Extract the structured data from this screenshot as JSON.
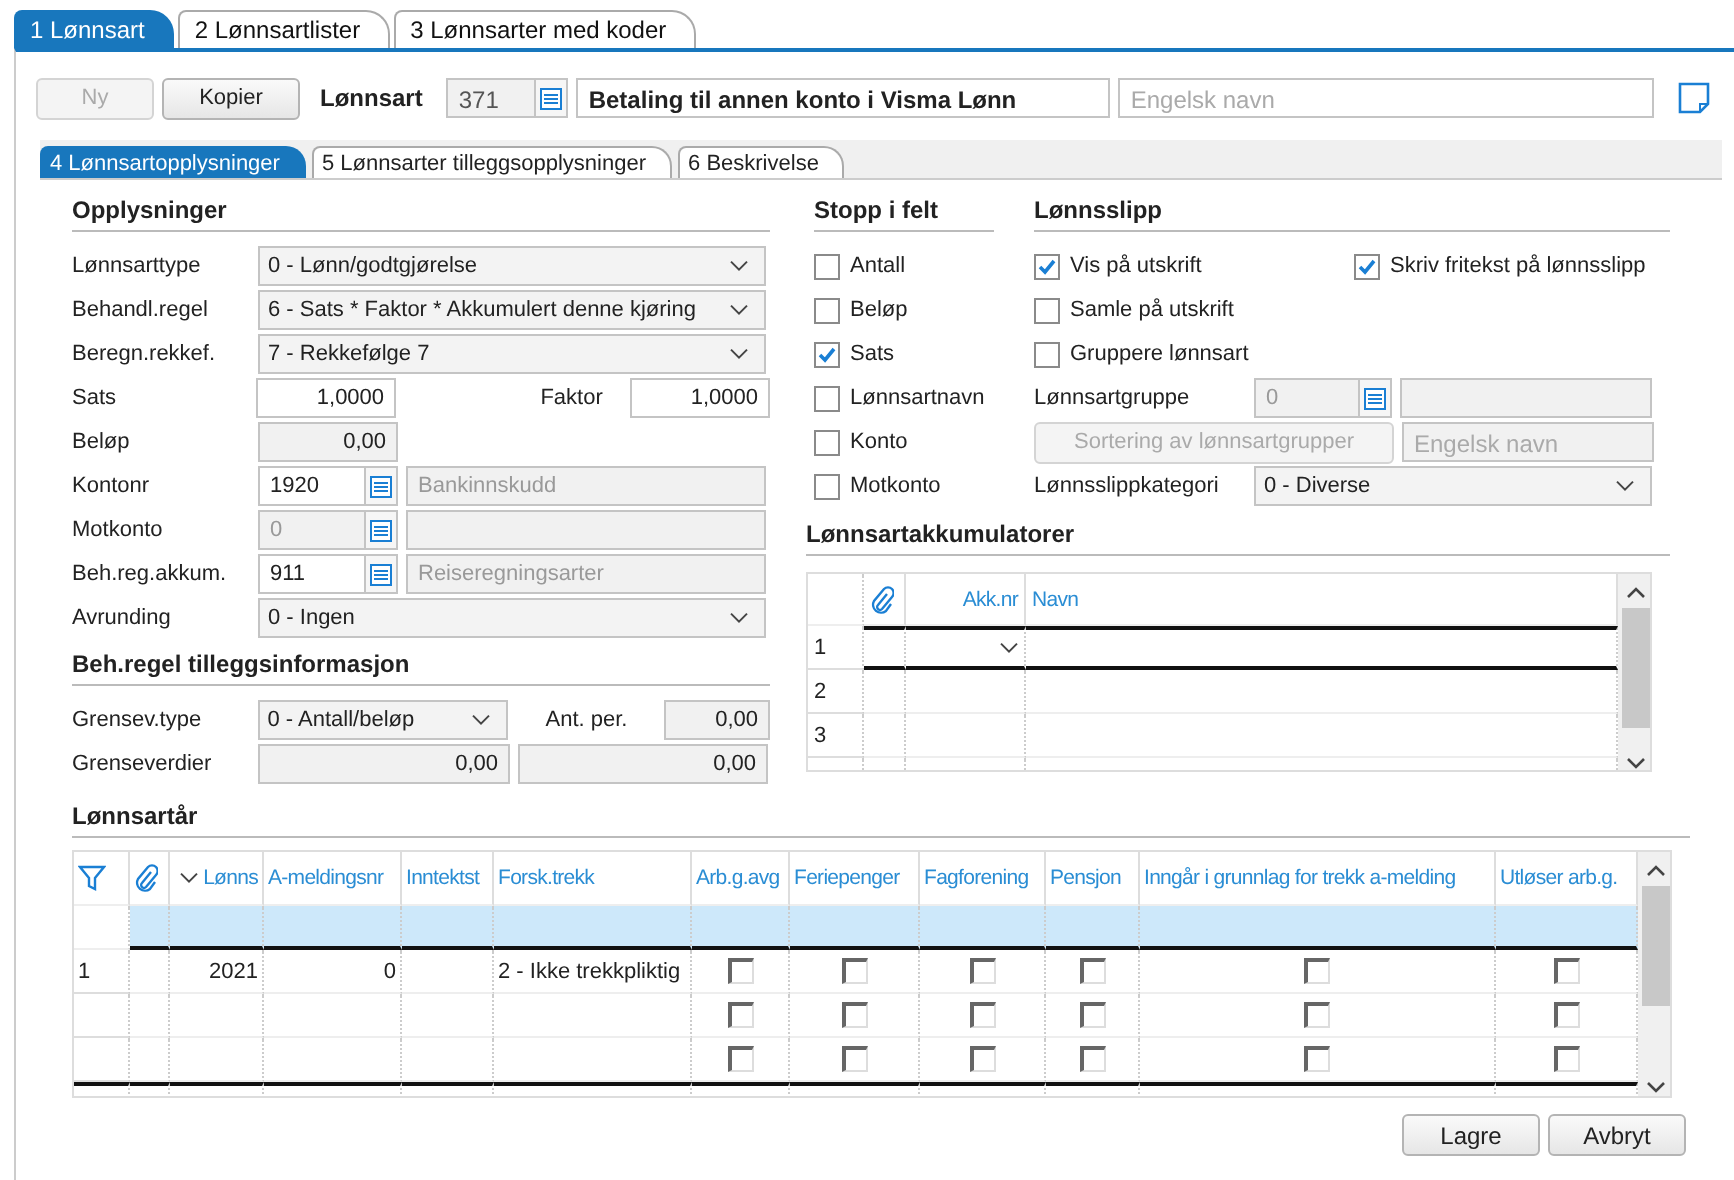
{
  "top_tabs": [
    {
      "label": "1 Lønnsart",
      "selected": true
    },
    {
      "label": "2 Lønnsartlister",
      "selected": false
    },
    {
      "label": "3 Lønnsarter med koder",
      "selected": false
    }
  ],
  "toolbar": {
    "buttons": [
      {
        "label": "Ny",
        "disabled": true
      },
      {
        "label": "Kopier",
        "disabled": false
      }
    ],
    "label": "Lønnsart",
    "number": "371",
    "name": "Betaling til annen konto i Visma Lønn",
    "english_placeholder": "Engelsk navn"
  },
  "sub_tabs": [
    {
      "label": "4 Lønnsartopplysninger",
      "selected": true
    },
    {
      "label": "5 Lønnsarter tilleggsopplysninger",
      "selected": false
    },
    {
      "label": "6 Beskrivelse",
      "selected": false
    }
  ],
  "opplysninger": {
    "title": "Opplysninger",
    "rows": [
      {
        "kind": "select",
        "label": "Lønnsarttype",
        "value": "0 - Lønn/godtgjørelse"
      },
      {
        "kind": "select",
        "label": "Behandl.regel",
        "value": "6 - Sats * Faktor * Akkumulert denne kjøring"
      },
      {
        "kind": "select",
        "label": "Beregn.rekkef.",
        "value": "7 - Rekkefølge 7"
      },
      {
        "kind": "pair",
        "label": "Sats",
        "value": "1,0000",
        "label2": "Faktor",
        "value2": "1,0000"
      },
      {
        "kind": "number",
        "label": "Beløp",
        "value": "0,00",
        "disabled": true
      },
      {
        "kind": "lookup",
        "label": "Kontonr",
        "value": "1920",
        "disabled": false,
        "description": "Bankinnskudd"
      },
      {
        "kind": "lookup",
        "label": "Motkonto",
        "value": "0",
        "disabled": true
      },
      {
        "kind": "lookup",
        "label": "Beh.reg.akkum.",
        "value": "911",
        "disabled": false,
        "description": "Reiseregningsarter"
      },
      {
        "kind": "select",
        "label": "Avrunding",
        "value": "0 - Ingen"
      }
    ]
  },
  "tilleggsinfo": {
    "title": "Beh.regel tilleggsinformasjon",
    "rows": [
      {
        "kind": "select_pair",
        "label": "Grensev.type",
        "value": "0 - Antall/beløp",
        "label2": "Ant. per.",
        "value2": "0,00"
      },
      {
        "kind": "double",
        "label": "Grenseverdier",
        "value": "0,00",
        "value2": "0,00"
      }
    ]
  },
  "stopp_i_felt": {
    "title": "Stopp i felt",
    "checkboxes": [
      {
        "label": "Antall",
        "checked": false
      },
      {
        "label": "Beløp",
        "checked": false
      },
      {
        "label": "Sats",
        "checked": true
      },
      {
        "label": "Lønnsartnavn",
        "checked": false
      },
      {
        "label": "Konto",
        "checked": false
      },
      {
        "label": "Motkonto",
        "checked": false
      }
    ]
  },
  "lonnsslipp": {
    "title": "Lønnsslipp",
    "checkboxes": [
      {
        "label": "Vis på utskrift",
        "checked": true
      },
      {
        "label": "Samle på utskrift",
        "checked": false
      },
      {
        "label": "Gruppere lønnsart",
        "checked": false
      }
    ],
    "side_checkbox": {
      "label": "Skriv fritekst på lønnsslipp",
      "checked": true
    },
    "group_label": "Lønnsartgruppe",
    "group_value": "0",
    "sort_button": "Sortering av lønnsartgrupper",
    "english_placeholder": "Engelsk navn",
    "category_label": "Lønnsslippkategori",
    "category_value": "0 - Diverse"
  },
  "akkumulatorer": {
    "title": "Lønnsartakkumulatorer",
    "columns": [
      "Akk.nr",
      "Navn"
    ],
    "rows": [
      {
        "number": "1",
        "current": true
      },
      {
        "number": "2",
        "current": false
      },
      {
        "number": "3",
        "current": false
      }
    ]
  },
  "lonnsartar": {
    "title": "Lønnsartår",
    "columns": [
      {
        "label": "Lønns",
        "sorted": true
      },
      {
        "label": "A-meldingsnr",
        "sorted": false
      },
      {
        "label": "Inntektst",
        "sorted": false
      },
      {
        "label": "Forsk.trekk",
        "sorted": false
      },
      {
        "label": "Arb.g.avg",
        "sorted": false
      },
      {
        "label": "Feriepenger",
        "sorted": false
      },
      {
        "label": "Fagforening",
        "sorted": false
      },
      {
        "label": "Pensjon",
        "sorted": false
      },
      {
        "label": "Inngår i grunnlag for trekk a-melding",
        "sorted": false
      },
      {
        "label": "Utløser arb.g.",
        "sorted": false
      }
    ],
    "rows": [
      {
        "number": "1",
        "year": "2021",
        "a_meldingsnr": "0",
        "forsk_trekk": "2 - Ikke trekkpliktig",
        "checks": [
          false,
          false,
          false,
          false,
          false,
          false
        ]
      },
      {
        "checks": [
          false,
          false,
          false,
          false,
          false,
          false
        ]
      },
      {
        "checks": [
          false,
          false,
          false,
          false,
          false,
          false
        ]
      }
    ]
  },
  "buttons": [
    "Lagre",
    "Avbryt"
  ]
}
